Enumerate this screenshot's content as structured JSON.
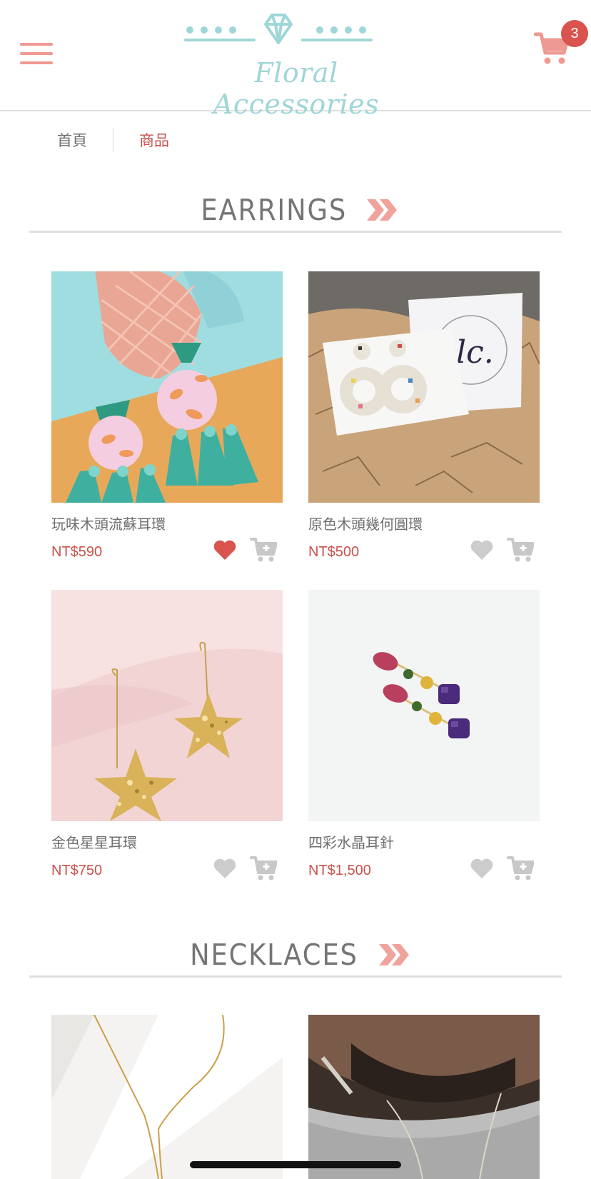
{
  "header": {
    "brand_name": "Floral Accessories",
    "cart_count": "3",
    "colors": {
      "brand": "#9fd6d8",
      "accent": "#ee9a92",
      "badge": "#d9534f",
      "price": "#c9524b"
    },
    "icons": {
      "menu": "hamburger-menu-icon",
      "cart": "shopping-cart-icon",
      "logo": "diamond-icon"
    }
  },
  "breadcrumb": {
    "items": [
      {
        "label": "首頁"
      },
      {
        "label": "商品"
      }
    ]
  },
  "sections": [
    {
      "title": "EARRINGS",
      "products": [
        {
          "name": "玩味木頭流蘇耳環",
          "price": "NT$590",
          "favorited": true
        },
        {
          "name": "原色木頭幾何圓環",
          "price": "NT$500",
          "favorited": false
        },
        {
          "name": "金色星星耳環",
          "price": "NT$750",
          "favorited": false
        },
        {
          "name": "四彩水晶耳針",
          "price": "NT$1,500",
          "favorited": false
        }
      ]
    },
    {
      "title": "NECKLACES",
      "products": []
    }
  ]
}
